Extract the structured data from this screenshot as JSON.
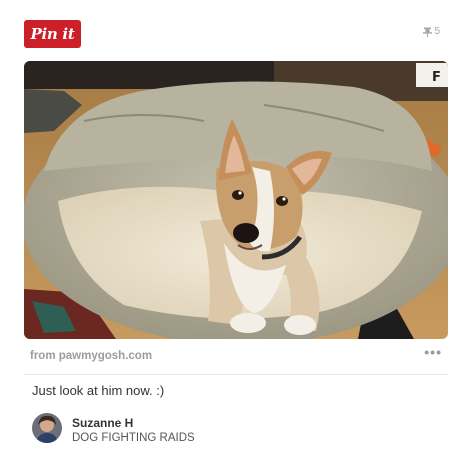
{
  "pin_button": {
    "label": "Pin it"
  },
  "repin_count": "5",
  "photo": {
    "subject": "Dog lying in a round dog bed"
  },
  "source": {
    "text": "from pawmygosh.com"
  },
  "more_options": {
    "label": "•••"
  },
  "description": "Just look at him now. :)",
  "pinner": {
    "name": "Suzanne H",
    "board": "DOG FIGHTING RAIDS"
  },
  "colors": {
    "pinterest_red": "#cb2027",
    "muted_text": "#9c9c9c"
  },
  "icons": {
    "repin": "pin-icon",
    "more": "ellipsis-icon"
  }
}
